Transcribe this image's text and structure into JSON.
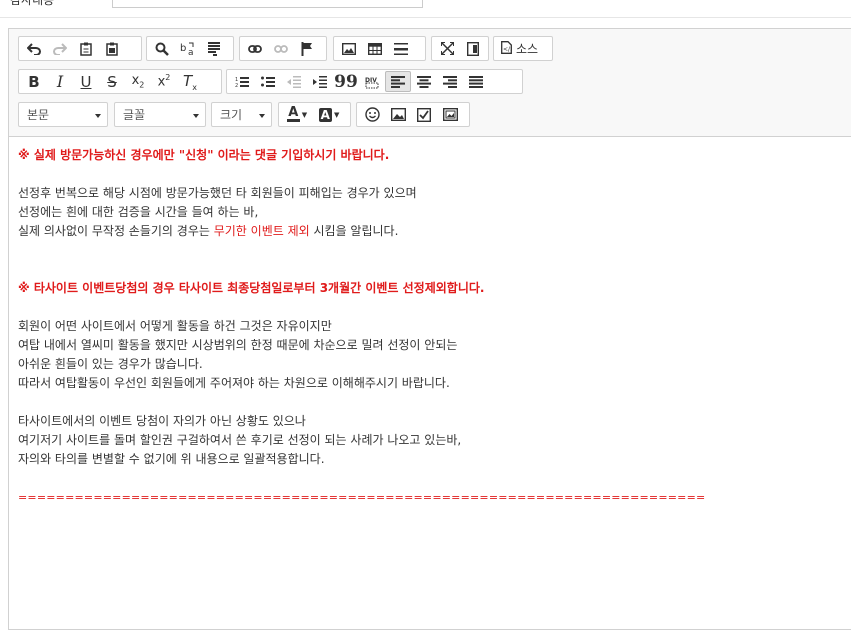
{
  "top_label": "감사내용",
  "toolbar": {
    "source_label": "소스",
    "format_combo": "본문",
    "font_combo": "글꼴",
    "size_combo": "크기",
    "font_color_label": "A",
    "bg_color_label": "A"
  },
  "content": {
    "line1": "※ 실제 방문가능하신 경우에만 \"신청\" 이라는 댓글 기입하시기 바랍니다.",
    "line2": "선정후 번복으로 해당 시점에 방문가능했던 타 회원들이 피해입는 경우가 있으며",
    "line3": "선정에는 흰에 대한 검증을 시간을 들여 하는 바,",
    "line4_a": "실제 의사없이 무작정 손들기의 경우는 ",
    "line4_b": "무기한 이벤트 제외",
    "line4_c": " 시킴을 알립니다.",
    "line5": "※ 타사이트 이벤트당첨의 경우 타사이트 최종당첨일로부터 3개월간 이벤트 선정제외합니다.",
    "line6": "회원이 어떤 사이트에서 어떻게 활동을 하건 그것은 자유이지만",
    "line7": "여탑 내에서 열씨미 활동을 했지만 시상범위의 한정 때문에 차순으로 밀려 선정이 안되는",
    "line8": "아쉬운 흰들이 있는 경우가 많습니다.",
    "line9": "따라서 여탑활동이 우선인 회원들에게 주어져야 하는 차원으로 이해해주시기 바랍니다.",
    "line10": "타사이트에서의 이벤트 당첨이 자의가 아닌 상황도 있으나",
    "line11": "여기저기 사이트를 돌며 할인권 구걸하여서 쓴 후기로 선정이 되는 사례가 나오고 있는바,",
    "line12": "자의와 타의를 변별할 수 없기에 위 내용으로 일괄적용합니다.",
    "divider": "========================================================================="
  },
  "colors": {
    "accent_red": "#e01b1b",
    "toolbar_bg": "#f8f8f8",
    "border": "#d1d1d1"
  }
}
